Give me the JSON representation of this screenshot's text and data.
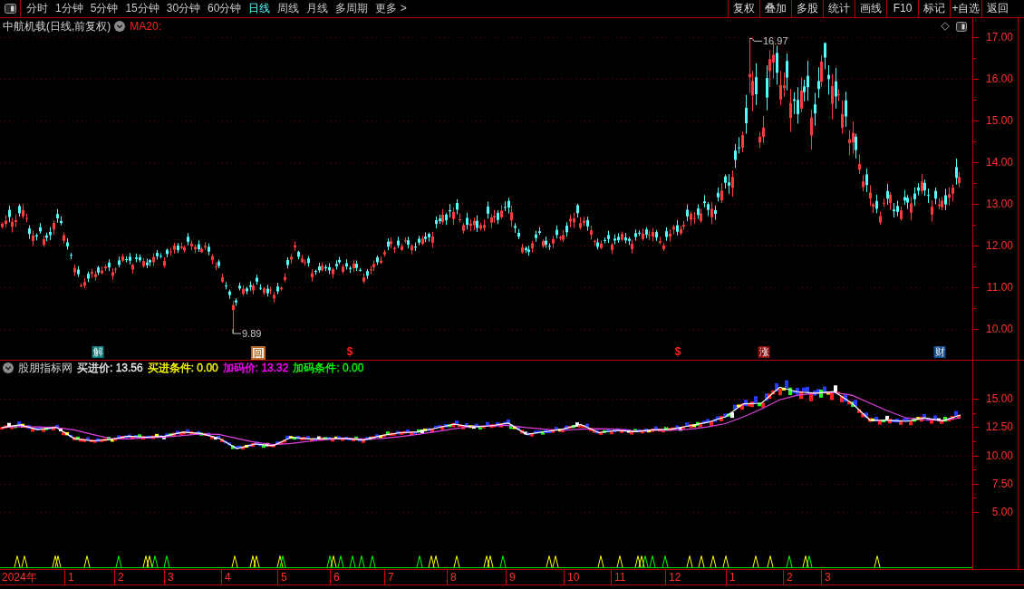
{
  "toolbar": {
    "periods": [
      {
        "label": "分时",
        "selected": false
      },
      {
        "label": "1分钟",
        "selected": false
      },
      {
        "label": "5分钟",
        "selected": false
      },
      {
        "label": "15分钟",
        "selected": false
      },
      {
        "label": "30分钟",
        "selected": false
      },
      {
        "label": "60分钟",
        "selected": false
      },
      {
        "label": "日线",
        "selected": true
      },
      {
        "label": "周线",
        "selected": false
      },
      {
        "label": "月线",
        "selected": false
      },
      {
        "label": "多周期",
        "selected": false
      },
      {
        "label": "更多 >",
        "selected": false
      }
    ],
    "actions": [
      "复权",
      "叠加",
      "多股",
      "统计",
      "画线",
      "F10",
      "标记",
      "+自选",
      "返回"
    ]
  },
  "price_panel": {
    "title": "中航机载(日线,前复权)",
    "indicator": "MA20:",
    "annotations": [
      {
        "kind": "high",
        "label": "16.97"
      },
      {
        "kind": "low",
        "label": "9.89"
      }
    ],
    "axis_labels": [
      "17.00",
      "16.00",
      "15.00",
      "14.00",
      "13.00",
      "12.00",
      "11.00",
      "10.00"
    ],
    "event_tags": [
      {
        "label": "解",
        "kind": "filled",
        "color": "#0e7c7b"
      },
      {
        "label": "回",
        "kind": "boxed",
        "color": "#b8682a"
      },
      {
        "label": "$",
        "kind": "plain",
        "color": "#ff2020"
      },
      {
        "label": "$",
        "kind": "plain",
        "color": "#ff2020"
      },
      {
        "label": "涨",
        "kind": "filled",
        "color": "#8b0a0a"
      },
      {
        "label": "财",
        "kind": "filled",
        "color": "#1c4f8f"
      }
    ]
  },
  "indicator_panel": {
    "name": "股朋指标网",
    "values": [
      {
        "label": "买进价: 13.56",
        "color": "#e6e6e6"
      },
      {
        "label": "买进条件: 0.00",
        "color": "#ffff00"
      },
      {
        "label": "加码价: 13.32",
        "color": "#ff00ff"
      },
      {
        "label": "加码条件: 0.00",
        "color": "#00ff00"
      }
    ],
    "chart_data": {
      "type": "line",
      "grid": true,
      "ylim": [
        2.2,
        17.16
      ],
      "yticks": [
        {
          "value": 15,
          "label": "15.00"
        },
        {
          "value": 12.5,
          "label": "12.50"
        },
        {
          "value": 10,
          "label": "10.00"
        },
        {
          "value": 7.5,
          "label": "7.50"
        },
        {
          "value": 5,
          "label": "5.00"
        }
      ],
      "series": [
        {
          "color": "#ffffff",
          "values": [
            12.45,
            12.69,
            12.27,
            12.47,
            11.5,
            11.28,
            11.4,
            11.69,
            11.6,
            11.7,
            12.05,
            11.94,
            11.51,
            10.6,
            11.0,
            10.85,
            11.6,
            11.45,
            11.48,
            11.5,
            11.35,
            11.75,
            12.0,
            12.07,
            12.4,
            12.75,
            12.5,
            12.6,
            12.85,
            11.86,
            12.08,
            12.3,
            12.72,
            12.0,
            12.2,
            12.1,
            12.25,
            12.3,
            12.6,
            12.9,
            13.4,
            14.55,
            14.6,
            16.02,
            15.6,
            15.5,
            15.63,
            14.6,
            13.1,
            13.1,
            13.0,
            13.3,
            13.05,
            13.56
          ]
        },
        {
          "color": "#e040e0",
          "values": [
            12.45,
            12.55,
            12.5,
            12.45,
            12.25,
            11.85,
            11.5,
            11.45,
            11.55,
            11.62,
            11.75,
            11.9,
            11.85,
            11.5,
            11.15,
            10.95,
            11.05,
            11.25,
            11.4,
            11.5,
            11.45,
            11.5,
            11.65,
            11.85,
            12.1,
            12.35,
            12.55,
            12.6,
            12.65,
            12.45,
            12.3,
            12.2,
            12.3,
            12.35,
            12.3,
            12.15,
            12.2,
            12.2,
            12.3,
            12.5,
            12.8,
            13.4,
            14.1,
            14.9,
            15.3,
            15.5,
            15.55,
            15.3,
            14.6,
            13.9,
            13.3,
            13.15,
            13.1,
            13.32
          ]
        }
      ]
    }
  },
  "time_axis": [
    "2024年",
    "1",
    "2",
    "3",
    "4",
    "5",
    "6",
    "7",
    "8",
    "9",
    "10",
    "11",
    "12",
    "1",
    "2",
    "3"
  ]
}
